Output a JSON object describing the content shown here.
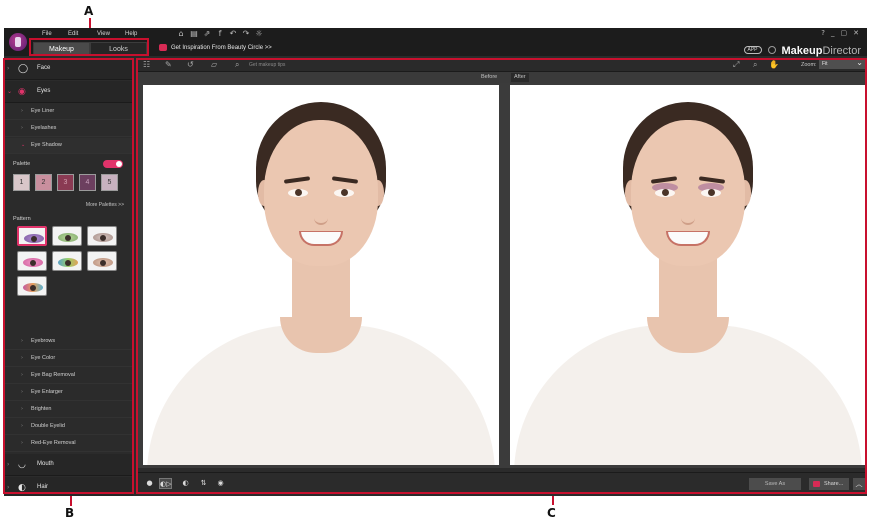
{
  "callouts": {
    "a": "A",
    "b": "B",
    "c": "C"
  },
  "menu": [
    "File",
    "Edit",
    "View",
    "Help"
  ],
  "toolbar_icons": [
    "home-icon",
    "save-icon",
    "share-icon",
    "facebook-icon",
    "undo-icon",
    "redo-icon",
    "settings-icon"
  ],
  "window_controls": [
    "?",
    "_",
    "▢",
    "✕"
  ],
  "tabs": {
    "makeup": "Makeup",
    "looks": "Looks"
  },
  "inspiration": "Get Inspiration From Beauty Circle >>",
  "brand": {
    "app_badge": "APP",
    "bold": "Makeup",
    "light": "Director"
  },
  "sidebar": {
    "sections": [
      {
        "label": "Face",
        "expanded": false
      },
      {
        "label": "Eyes",
        "expanded": true
      },
      {
        "label": "Mouth",
        "expanded": false
      },
      {
        "label": "Hair",
        "expanded": false
      }
    ],
    "eye_items": [
      "Eye Liner",
      "Eyelashes",
      "Eye Shadow",
      "Eyebrows",
      "Eye Color",
      "Eye Bag Removal",
      "Eye Enlarger",
      "Brighten",
      "Double Eyelid",
      "Red-Eye Removal"
    ],
    "palette": {
      "label": "Palette",
      "toggle_on": true,
      "swatches": [
        {
          "label": "1",
          "color": "#d9c6c9"
        },
        {
          "label": "2",
          "color": "#c98f9e"
        },
        {
          "label": "3",
          "color": "#8a3a53"
        },
        {
          "label": "4",
          "color": "#6c3f5f"
        },
        {
          "label": "5",
          "color": "#c8b1bf"
        }
      ],
      "more": "More Palettes >>"
    },
    "pattern": {
      "label": "Pattern",
      "colors": [
        "#7a5a9e",
        "#7fa86a",
        "#a38a84",
        "#d05a9a",
        "#5aa0c8",
        "#b58a76",
        "#c25aa0"
      ]
    }
  },
  "main_toolbar": {
    "tip": "Get makeup tips",
    "zoom_label": "Zoom:",
    "zoom_value": "Fit"
  },
  "compare": {
    "before": "Before",
    "after": "After"
  },
  "bottom": {
    "buttons": [
      "●",
      "◐▷",
      "◐",
      "⇅",
      "◉"
    ],
    "save_as": "Save As",
    "share": "Share...",
    "collapse": "︿"
  },
  "colors": {
    "accent": "#e0336a",
    "callout": "#c8102e"
  }
}
